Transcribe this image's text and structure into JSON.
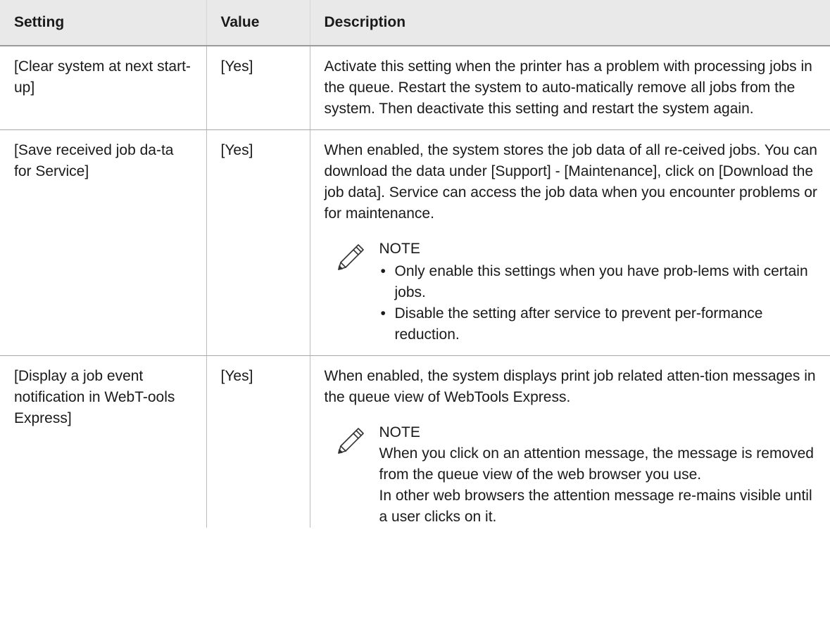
{
  "table": {
    "headers": {
      "setting": "Setting",
      "value": "Value",
      "description": "Description"
    },
    "rows": [
      {
        "setting": "[Clear system at next start-up]",
        "value": "[Yes]",
        "description": "Activate this setting when the printer has a problem with processing jobs in the queue. Restart the system to auto-matically remove all jobs from the system. Then deactivate this setting and restart the system again."
      },
      {
        "setting": "[Save received job da-ta for Service]",
        "value": "[Yes]",
        "description": "When enabled, the system stores the job data of all re-ceived jobs. You can download the data under [Support] - [Maintenance], click on [Download the job data]. Service can access the job data when you encounter problems or for maintenance.",
        "note": {
          "title": "NOTE",
          "bullets": [
            "Only enable this settings when you have prob-lems with certain jobs.",
            "Disable the setting after service to prevent per-formance reduction."
          ]
        }
      },
      {
        "setting": "[Display a job event notification in WebT-ools Express]",
        "value": "[Yes]",
        "description": "When enabled, the system displays print job related atten-tion messages in the queue view of WebTools Express.",
        "note": {
          "title": "NOTE",
          "paragraphs": [
            "When you click on an attention message, the message is removed from the queue view of the web browser you use.",
            "In other web browsers the attention message re-mains visible until a user clicks on it."
          ]
        }
      }
    ]
  },
  "icons": {
    "note": "pencil-note-icon"
  }
}
